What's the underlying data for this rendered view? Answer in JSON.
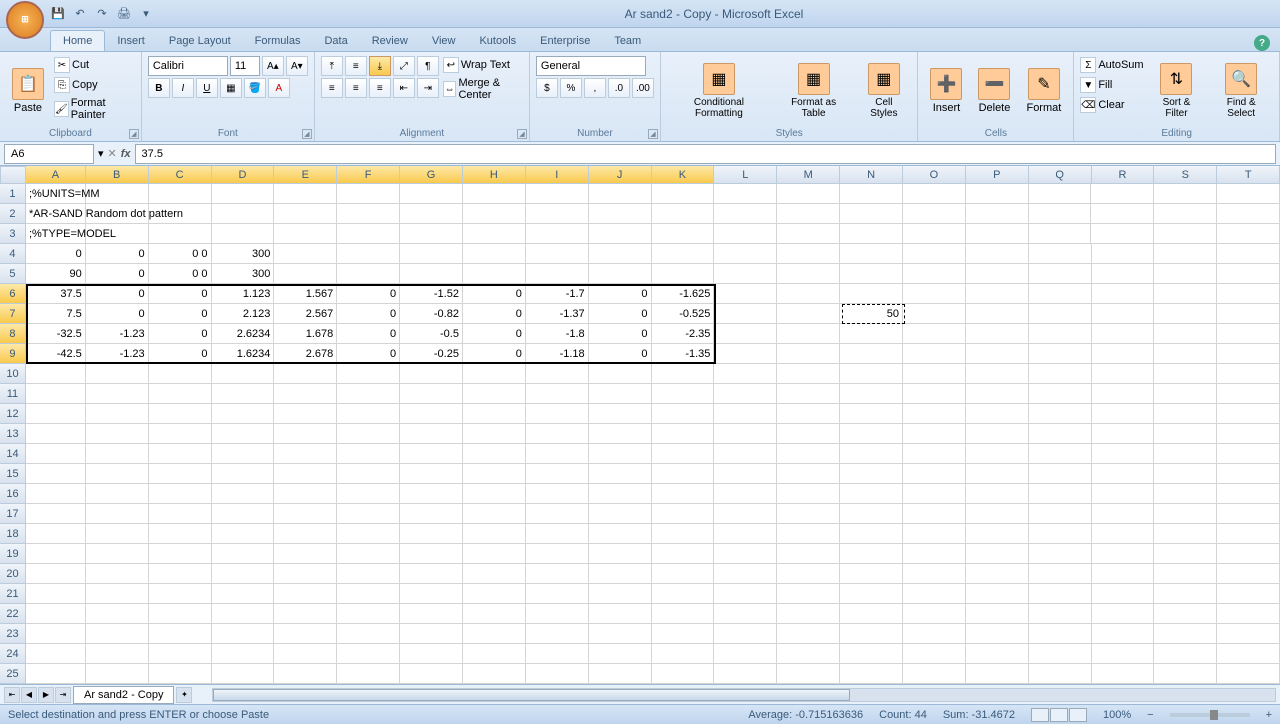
{
  "title": "Ar sand2 - Copy - Microsoft Excel",
  "tabs": [
    "Home",
    "Insert",
    "Page Layout",
    "Formulas",
    "Data",
    "Review",
    "View",
    "Kutools",
    "Enterprise",
    "Team"
  ],
  "active_tab": 0,
  "ribbon": {
    "clipboard": {
      "label": "Clipboard",
      "paste": "Paste",
      "cut": "Cut",
      "copy": "Copy",
      "format_painter": "Format Painter"
    },
    "font": {
      "label": "Font",
      "name": "Calibri",
      "size": "11"
    },
    "alignment": {
      "label": "Alignment",
      "wrap": "Wrap Text",
      "merge": "Merge & Center"
    },
    "number": {
      "label": "Number",
      "format": "General"
    },
    "styles": {
      "label": "Styles",
      "cond": "Conditional Formatting",
      "table": "Format as Table",
      "cell": "Cell Styles"
    },
    "cells": {
      "label": "Cells",
      "insert": "Insert",
      "delete": "Delete",
      "format": "Format"
    },
    "editing": {
      "label": "Editing",
      "autosum": "AutoSum",
      "fill": "Fill",
      "clear": "Clear",
      "sort": "Sort & Filter",
      "find": "Find & Select"
    }
  },
  "name_box": "A6",
  "formula_value": "37.5",
  "columns": [
    "A",
    "B",
    "C",
    "D",
    "E",
    "F",
    "G",
    "H",
    "I",
    "J",
    "K",
    "L",
    "M",
    "N",
    "O",
    "P",
    "Q",
    "R",
    "S",
    "T"
  ],
  "sel_cols": [
    "A",
    "B",
    "C",
    "D",
    "E",
    "F",
    "G",
    "H",
    "I",
    "J",
    "K"
  ],
  "sel_rows": [
    6,
    7,
    8,
    9
  ],
  "rows": [
    {
      "n": 1,
      "txt": ";%UNITS=MM"
    },
    {
      "n": 2,
      "txt": "*AR-SAND Random dot pattern"
    },
    {
      "n": 3,
      "txt": ";%TYPE=MODEL"
    },
    {
      "n": 4,
      "cells": [
        "0",
        "0",
        "0 0",
        "300",
        "",
        "",
        "",
        "",
        "",
        "",
        ""
      ]
    },
    {
      "n": 5,
      "cells": [
        "90",
        "0",
        "0 0",
        "300",
        "",
        "",
        "",
        "",
        "",
        "",
        ""
      ]
    },
    {
      "n": 6,
      "cells": [
        "37.5",
        "0",
        "0",
        "1.123",
        "1.567",
        "0",
        "-1.52",
        "0",
        "-1.7",
        "0",
        "-1.625"
      ]
    },
    {
      "n": 7,
      "cells": [
        "7.5",
        "0",
        "0",
        "2.123",
        "2.567",
        "0",
        "-0.82",
        "0",
        "-1.37",
        "0",
        "-0.525"
      ]
    },
    {
      "n": 8,
      "cells": [
        "-32.5",
        "-1.23",
        "0",
        "2.6234",
        "1.678",
        "0",
        "-0.5",
        "0",
        "-1.8",
        "0",
        "-2.35"
      ]
    },
    {
      "n": 9,
      "cells": [
        "-42.5",
        "-1.23",
        "0",
        "1.6234",
        "2.678",
        "0",
        "-0.25",
        "0",
        "-1.18",
        "0",
        "-1.35"
      ]
    }
  ],
  "floating_cell": {
    "col": "N",
    "row": 7,
    "value": "50"
  },
  "sheet_tab": "Ar sand2 - Copy",
  "status": {
    "msg": "Select destination and press ENTER or choose Paste",
    "avg": "Average: -0.715163636",
    "count": "Count: 44",
    "sum": "Sum: -31.4672",
    "zoom": "100%"
  }
}
